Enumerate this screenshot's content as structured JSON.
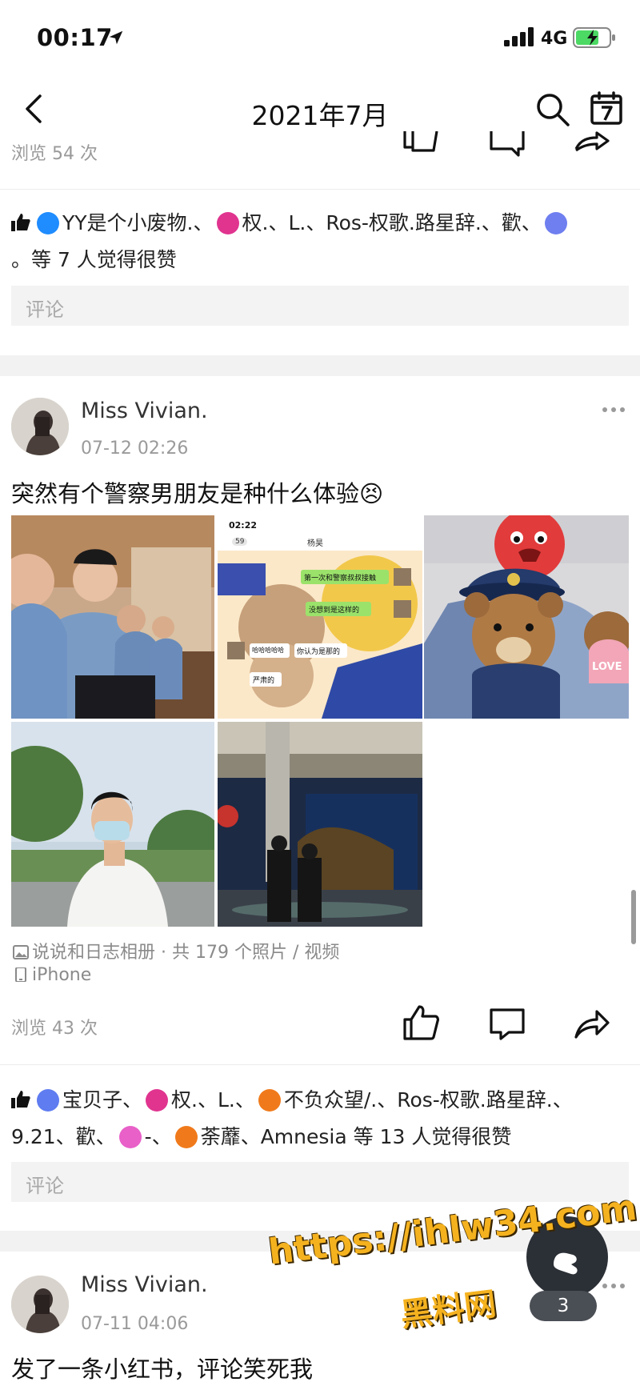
{
  "status_bar": {
    "time": "00:17",
    "network": "4G"
  },
  "nav": {
    "title": "2021年7月"
  },
  "post_prev": {
    "views": "浏览 54 次",
    "likes_line1_a": "YY是个小废物.、",
    "likes_line1_b": "权.、L.、Ros-权歌.路星辞.、歡、",
    "likes_line2": "。等 7 人觉得很赞",
    "comment_placeholder": "评论"
  },
  "post_main": {
    "author": "Miss Vivian.",
    "time": "07-12 02:26",
    "text": "突然有个警察男朋友是种什么体验😣",
    "album": "说说和日志相册 · 共 179 个照片 / 视频",
    "device": "iPhone",
    "views": "浏览 43 次",
    "likes_seg1": "宝贝子、",
    "likes_seg2": "权.、L.、",
    "likes_seg3": "不负众望/.、Ros-权歌.路星辞.、",
    "likes_line2_a": "9.21、歡、",
    "likes_line2_b": "-、",
    "likes_line2_c": "荼蘼、Amnesia 等 13 人觉得很赞",
    "comment_placeholder": "评论",
    "photo2_time": "02:22",
    "photo2_back": "59",
    "photo2_name": "杨昊",
    "photo2_msg1": "第一次和警察叔叔接触",
    "photo2_msg2": "没想到是这样的",
    "photo2_msg3": "哈哈哈哈哈",
    "photo2_msg4": "你认为是那的",
    "photo2_msg5": "严肃的",
    "photo3_text": "LOVE"
  },
  "post_next": {
    "author": "Miss Vivian.",
    "time": "07-11 04:06",
    "text": "发了一条小红书，评论笑死我"
  },
  "fab_badge": "3",
  "watermark": {
    "url": "https://ihlw34.com",
    "name": "黑料网"
  },
  "colors": {
    "accent": "#1f8cff",
    "pink": "#e0348f",
    "orange": "#f07a1b",
    "comment_bg": "#f3f3f3"
  }
}
